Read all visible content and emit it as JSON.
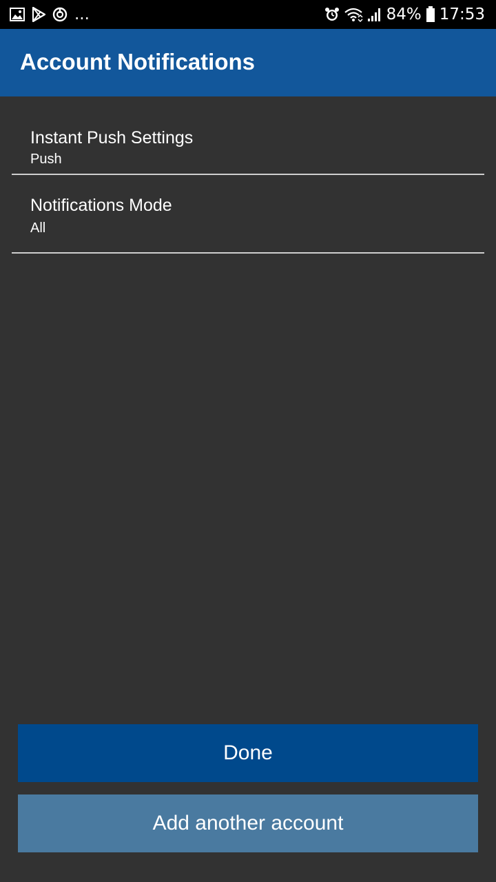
{
  "status_bar": {
    "left_icons": [
      "gallery-icon",
      "play-store-icon",
      "sync-icon",
      "more-dots-icon"
    ],
    "more_text": "...",
    "right_icons": [
      "alarm-icon",
      "wifi-icon",
      "signal-icon",
      "battery-icon"
    ],
    "battery": "84%",
    "time": "17:53"
  },
  "app_bar": {
    "title": "Account Notifications",
    "color": "#12579b"
  },
  "settings": {
    "items": [
      {
        "title": "Instant Push Settings",
        "value": "Push"
      },
      {
        "title": "Notifications Mode",
        "value": "All"
      }
    ]
  },
  "buttons": {
    "done_label": "Done",
    "add_account_label": "Add another account",
    "done_color": "#00498c",
    "add_color": "#4a7aa0"
  },
  "colors": {
    "background": "#323232",
    "divider": "#cfcfcf"
  }
}
